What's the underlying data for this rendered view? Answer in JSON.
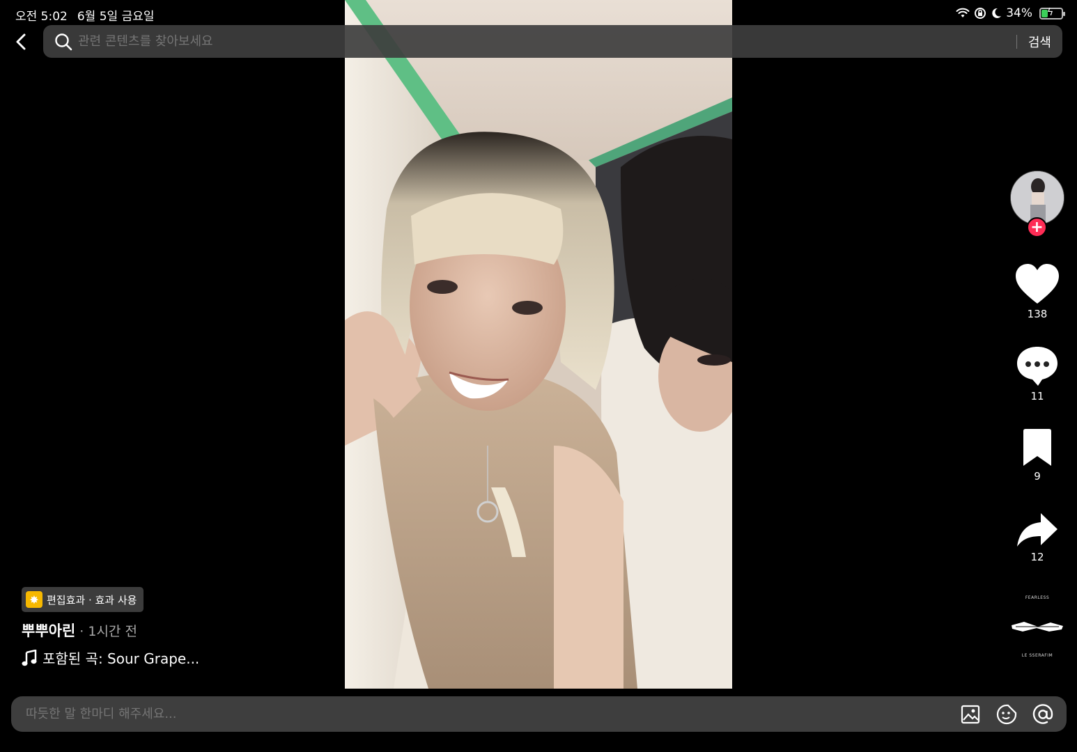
{
  "status_bar": {
    "time": "오전 5:02",
    "date": "6월 5일 금요일",
    "battery": "34%",
    "battery_level": 0.34,
    "icons": [
      "wifi-icon",
      "orientation-lock-icon",
      "do-not-disturb-icon",
      "battery-charging-icon"
    ]
  },
  "search": {
    "placeholder": "관련 콘텐츠를 찾아보세요",
    "submit_label": "검색"
  },
  "actions": {
    "likes": "138",
    "comments": "11",
    "bookmarks": "9",
    "shares": "12",
    "follow_label": "+"
  },
  "music_disc": {
    "top_text": "FEARLESS",
    "bottom_text": "LE SSERAFIM"
  },
  "post": {
    "effect_badge": "편집효과 · 효과 사용",
    "author": "뿌뿌아린",
    "time_ago": "· 1시간 전",
    "music": "포함된 곡: Sour Grape..."
  },
  "comment": {
    "placeholder": "따듯한 말 한마디 해주세요..."
  },
  "colors": {
    "background": "#000000",
    "search_bar": "#3e3e3e",
    "follow_button": "#fe2c55",
    "effect_icon": "#f6b800",
    "battery_fill": "#3cd15a"
  }
}
